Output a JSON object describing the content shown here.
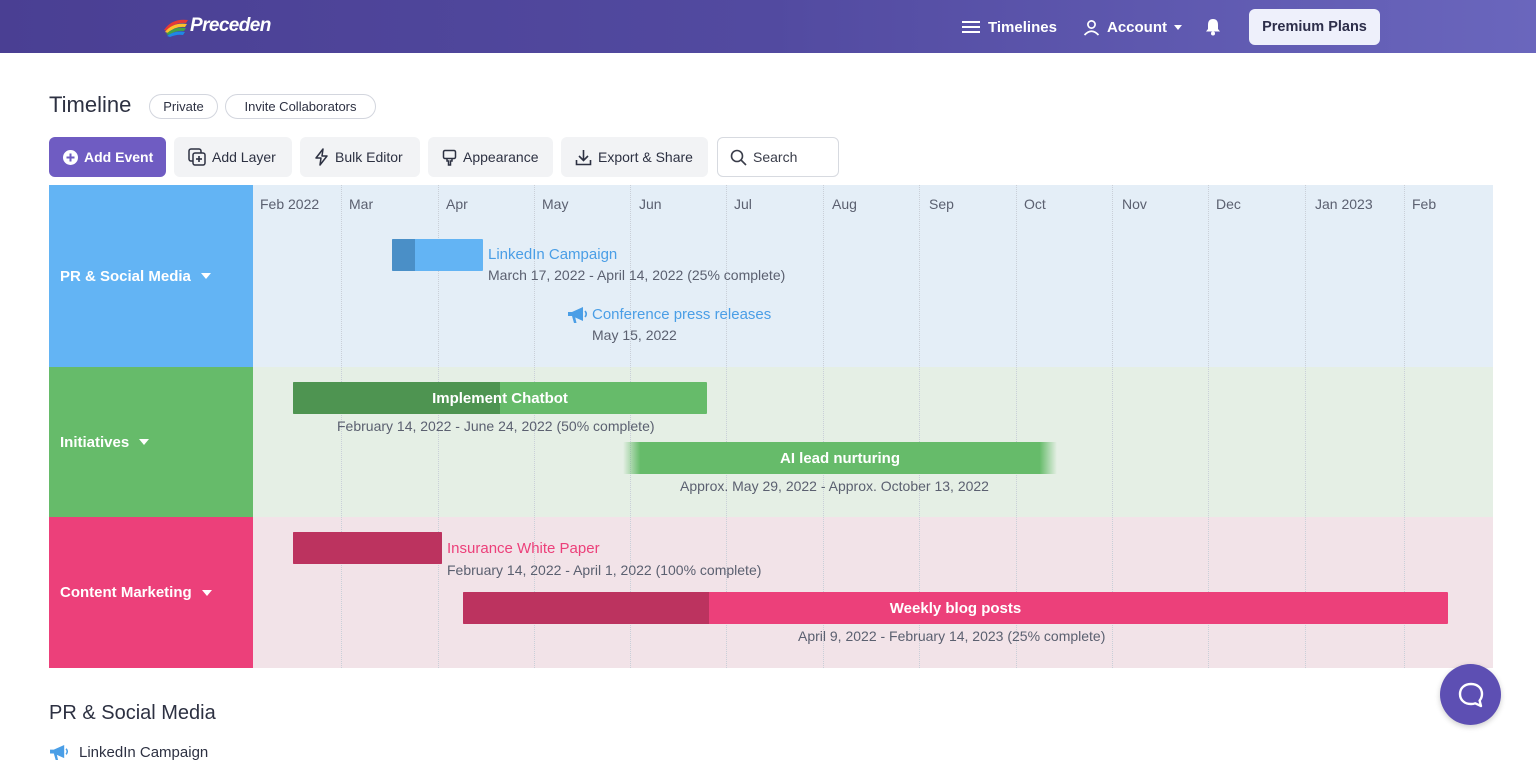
{
  "nav": {
    "brand": "Preceden",
    "timelines": "Timelines",
    "account": "Account",
    "premium": "Premium Plans"
  },
  "page": {
    "title": "Timeline",
    "privacy": "Private",
    "invite": "Invite Collaborators"
  },
  "toolbar": {
    "add_event": "Add Event",
    "add_layer": "Add Layer",
    "bulk_editor": "Bulk Editor",
    "appearance": "Appearance",
    "export_share": "Export & Share",
    "search_placeholder": "Search"
  },
  "timeline": {
    "months": [
      "Feb 2022",
      "Mar",
      "Apr",
      "May",
      "Jun",
      "Jul",
      "Aug",
      "Sep",
      "Oct",
      "Nov",
      "Dec",
      "Jan 2023",
      "Feb"
    ],
    "layers": [
      {
        "name": "PR & Social Media",
        "color": "#63b4f4",
        "bg": "#e4eef7"
      },
      {
        "name": "Initiatives",
        "color": "#66bb6a",
        "bg": "#e5efe5"
      },
      {
        "name": "Content Marketing",
        "color": "#ec407a",
        "bg": "#f2e3e8"
      }
    ],
    "events": [
      {
        "title": "LinkedIn Campaign",
        "date": "March 17, 2022 - April 14, 2022 (25% complete)",
        "color": "#63b4f4",
        "progress_color": "#4a8fc7",
        "progress": 0.25
      },
      {
        "title": "Conference press releases",
        "date": "May 15, 2022",
        "color": "#63b4f4",
        "icon": "megaphone-icon"
      },
      {
        "title": "Implement Chatbot",
        "date": "February 14, 2022 - June 24, 2022 (50% complete)",
        "color": "#66bb6a",
        "progress_color": "#4e9451",
        "progress": 0.5
      },
      {
        "title": "AI lead nurturing",
        "date": "Approx. May 29, 2022 - Approx. October 13, 2022",
        "color": "#66bb6a"
      },
      {
        "title": "Insurance White Paper",
        "date": "February 14, 2022 - April 1, 2022 (100% complete)",
        "color": "#ec407a",
        "progress_color": "#bc335f",
        "progress": 1.0
      },
      {
        "title": "Weekly blog posts",
        "date": "April 9, 2022 - February 14, 2023 (25% complete)",
        "color": "#ec407a",
        "progress_color": "#bc335f",
        "progress": 0.25
      }
    ]
  },
  "list": {
    "section_title": "PR & Social Media",
    "first_item": "LinkedIn Campaign"
  }
}
